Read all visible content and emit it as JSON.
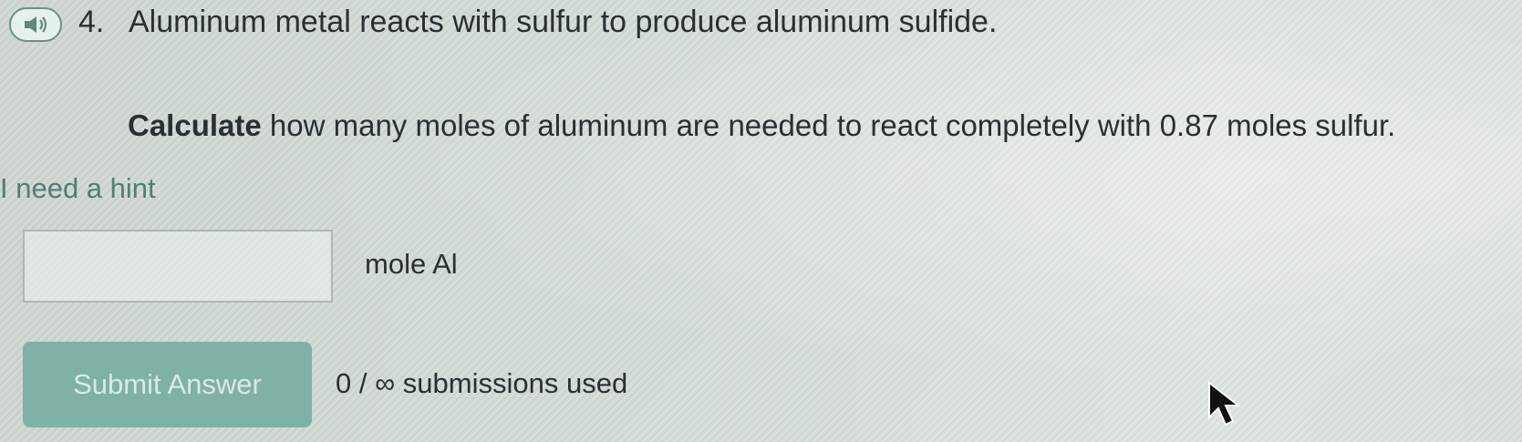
{
  "question": {
    "number": "4.",
    "text": "Aluminum metal reacts with sulfur to produce aluminum sulfide.",
    "speaker_icon": "speaker-icon"
  },
  "instruction": {
    "emphasis": "Calculate",
    "rest": " how many moles of aluminum are needed to react completely with 0.87 moles sulfur."
  },
  "hint": {
    "label": "I need a hint"
  },
  "answer": {
    "value": "",
    "unit": "mole Al"
  },
  "submit": {
    "label": "Submit Answer",
    "counter": "0 / ∞ submissions used"
  },
  "colors": {
    "accent": "#4f7f73",
    "button": "#7fb1a6"
  },
  "cursor_icon": "mouse-pointer-icon"
}
